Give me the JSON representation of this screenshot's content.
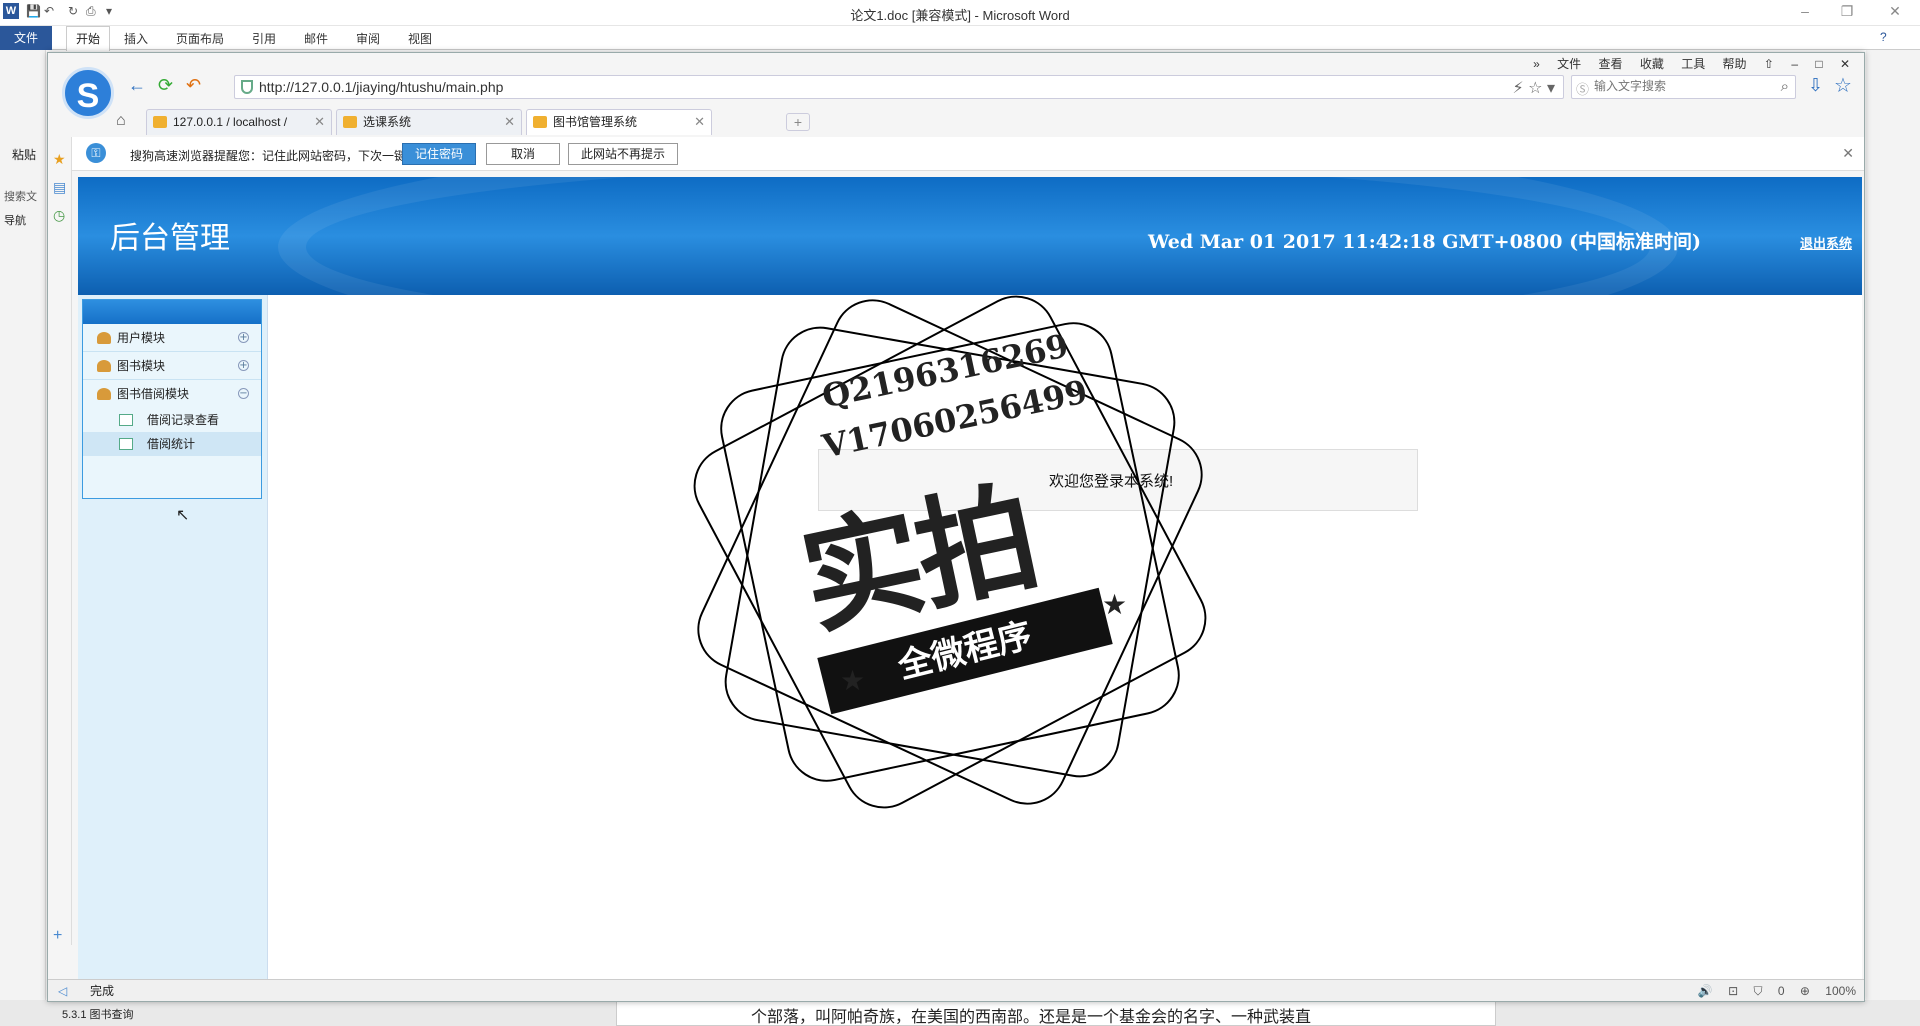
{
  "word": {
    "title": "论文1.doc [兼容模式] - Microsoft Word",
    "ribbon_tabs": [
      "文件",
      "开始",
      "插入",
      "页面布局",
      "引用",
      "邮件",
      "审阅",
      "视图"
    ],
    "paste_label": "粘贴",
    "nav_label": "导航",
    "search_doc_label": "搜索文",
    "doc_text": "个部落，叫阿帕奇族，在美国的西南部。还是是一个基金会的名字、一种武装直",
    "nav_item": "5.3.1 图书查询"
  },
  "browser": {
    "top_menu": [
      "文件",
      "查看",
      "收藏",
      "工具",
      "帮助"
    ],
    "url": "http://127.0.0.1/jiaying/htushu/main.php",
    "search_placeholder": "输入文字搜索",
    "tabs": [
      {
        "label": "127.0.0.1 / localhost /"
      },
      {
        "label": "选课系统"
      },
      {
        "label": "图书馆管理系统"
      }
    ],
    "infobar": {
      "text": "搜狗高速浏览器提醒您：记住此网站密码，下次一键登录！",
      "remember": "记住密码",
      "cancel": "取消",
      "noshow": "此网站不再提示"
    },
    "status": "完成",
    "zoom": "100%",
    "badge_count": "0"
  },
  "page": {
    "banner_title": "后台管理",
    "clock": "Wed Mar 01 2017 11:42:18 GMT+0800 (中国标准时间)",
    "logout": "退出系统",
    "menu": [
      {
        "label": "用户模块",
        "expanded": false
      },
      {
        "label": "图书模块",
        "expanded": false
      },
      {
        "label": "图书借阅模块",
        "expanded": true
      }
    ],
    "submenu": [
      "借阅记录查看",
      "借阅统计"
    ],
    "welcome": "欢迎您登录本系统!"
  },
  "watermark": {
    "line1": "Q2196316269",
    "line2": "V17060256499",
    "big": "实拍",
    "ribbon": "全微程序"
  }
}
